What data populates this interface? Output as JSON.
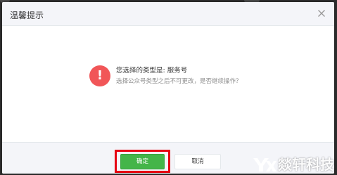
{
  "dialog": {
    "title": "温馨提示",
    "close_icon": "close-icon"
  },
  "message": {
    "icon": "warning-icon",
    "icon_glyph": "!",
    "icon_color": "#f15658",
    "title": "您选择的类型是: 服务号",
    "description": "选择公众号类型之后不可更改，是否继续操作？"
  },
  "footer": {
    "confirm_label": "确定",
    "cancel_label": "取消",
    "confirm_color": "#44b549",
    "highlight_color": "#e60012"
  },
  "watermark": {
    "logo_text": "YX",
    "text": "燚轩科技"
  }
}
